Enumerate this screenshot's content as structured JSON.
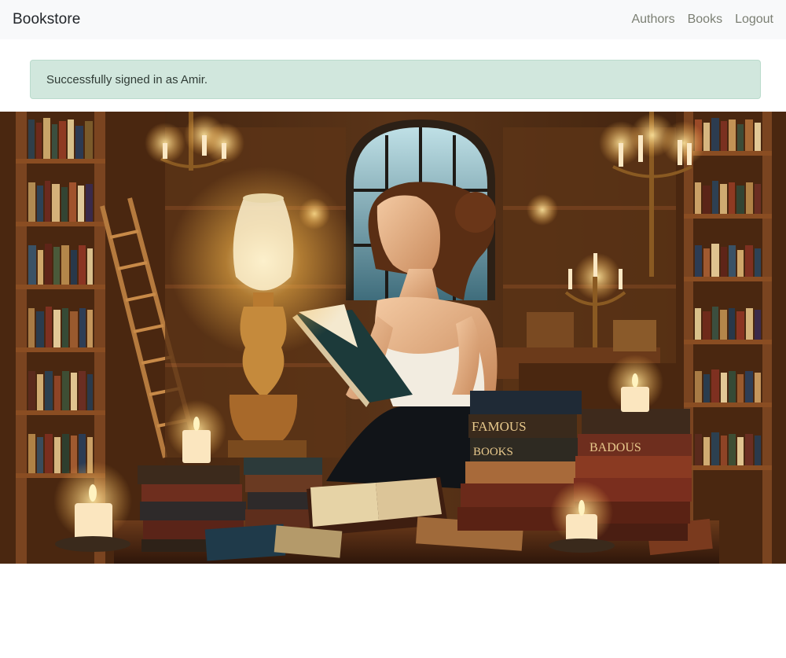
{
  "navbar": {
    "brand": "Bookstore",
    "links": [
      "Authors",
      "Books",
      "Logout"
    ]
  },
  "alert": {
    "message": "Successfully signed in as Amir."
  },
  "hero": {
    "book_spines": [
      "FAMOUS",
      "BOOKS",
      "BADOUS"
    ]
  },
  "colors": {
    "navbar_bg": "#f8f9fa",
    "alert_bg": "#d1e7dd",
    "alert_border": "#badbcc",
    "nav_link": "#7b7f73"
  }
}
